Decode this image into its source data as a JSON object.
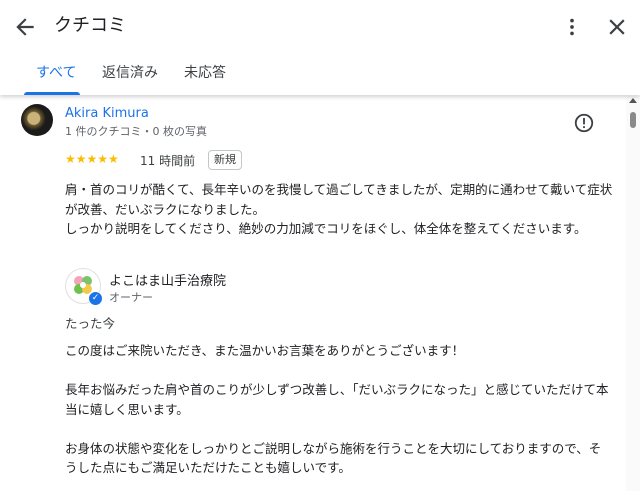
{
  "header": {
    "title": "クチコミ",
    "tabs": [
      {
        "label": "すべて",
        "active": true
      },
      {
        "label": "返信済み",
        "active": false
      },
      {
        "label": "未応答",
        "active": false
      }
    ]
  },
  "review": {
    "author": "Akira Kimura",
    "author_meta": "1 件のクチコミ・0 枚の写真",
    "rating": 5,
    "stars": "★★★★★",
    "time": "11 時間前",
    "badge": "新規",
    "text_lines": [
      "肩・首のコリが酷くて、長年辛いのを我慢して過ごしてきましたが、定期的に通わせて戴いて症状が改善、だいぶラクになりました。",
      "しっかり説明をしてくださり、絶妙の力加減でコリをほぐし、体全体を整えてくださいます。"
    ]
  },
  "reply": {
    "owner_name": "よこはま山手治療院",
    "owner_role": "オーナー",
    "time": "たった今",
    "paragraphs": [
      "この度はご来院いただき、また温かいお言葉をありがとうございます！",
      "長年お悩みだった肩や首のこりが少しずつ改善し、「だいぶラクになった」と感じていただけて本当に嬉しく思います。",
      "お身体の状態や変化をしっかりとご説明しながら施術を行うことを大切にしておりますので、そうした点にもご満足いただけたことも嬉しいです。"
    ]
  },
  "colors": {
    "accent": "#1a73e8",
    "star": "#fbbc04"
  },
  "icons": {
    "back": "arrow-back-icon",
    "more": "more-vert-icon",
    "close": "close-icon",
    "flag": "report-icon",
    "verified": "verified-check-icon"
  }
}
